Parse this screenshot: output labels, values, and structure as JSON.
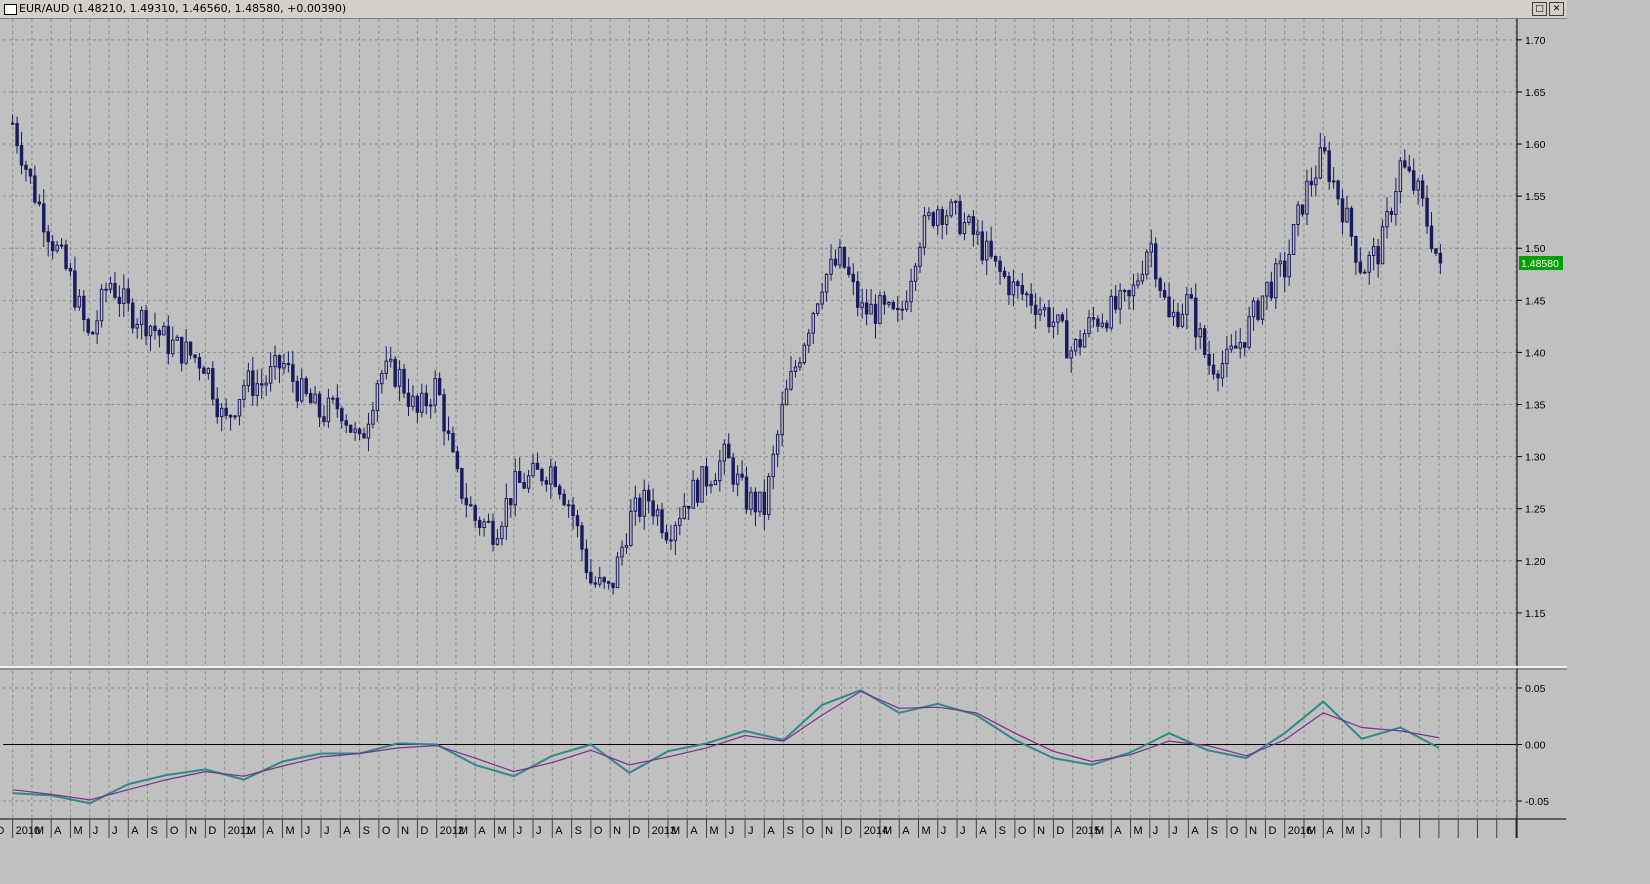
{
  "window": {
    "title": "EUR/AUD (1.48210, 1.49310, 1.46560, 1.48580, +0.00390)",
    "restore_glyph": "□",
    "close_glyph": "✕"
  },
  "colors": {
    "background": "#c0c0c0",
    "candle": "#1a1a5e",
    "grid": "#8c8c8c",
    "fast_line": "#2e8b83",
    "slow_line": "#7b2d8e",
    "price_tag_bg": "#00a000",
    "price_tag_text": "#ffffff"
  },
  "chart_data": [
    {
      "type": "candlestick",
      "title": "EUR/AUD",
      "last_price": "1.48580",
      "ylim": [
        1.1,
        1.72
      ],
      "y_ticks": [
        "1.70",
        "1.65",
        "1.60",
        "1.55",
        "1.50",
        "1.45",
        "1.40",
        "1.35",
        "1.30",
        "1.25",
        "1.20",
        "1.15"
      ],
      "grid": true,
      "x_labels": [
        "D",
        "2010",
        "M",
        "A",
        "M",
        "J",
        "J",
        "A",
        "S",
        "O",
        "N",
        "D",
        "2011",
        "M",
        "A",
        "M",
        "J",
        "J",
        "A",
        "S",
        "O",
        "N",
        "D",
        "2012",
        "M",
        "A",
        "M",
        "J",
        "J",
        "A",
        "S",
        "O",
        "N",
        "D",
        "2013",
        "M",
        "A",
        "M",
        "J",
        "J",
        "A",
        "S",
        "O",
        "N",
        "D",
        "2014",
        "M",
        "A",
        "M",
        "J",
        "J",
        "A",
        "S",
        "O",
        "N",
        "D",
        "2015",
        "M",
        "A",
        "M",
        "J",
        "J",
        "A",
        "S",
        "O",
        "N",
        "D",
        "2016",
        "M",
        "A",
        "M",
        "J"
      ],
      "close_path": [
        [
          "2010-01",
          1.62
        ],
        [
          "2010-02",
          1.56
        ],
        [
          "2010-03",
          1.51
        ],
        [
          "2010-04",
          1.47
        ],
        [
          "2010-05",
          1.41
        ],
        [
          "2010-06",
          1.47
        ],
        [
          "2010-07",
          1.44
        ],
        [
          "2010-08",
          1.43
        ],
        [
          "2010-09",
          1.41
        ],
        [
          "2010-10",
          1.4
        ],
        [
          "2010-11",
          1.39
        ],
        [
          "2010-12",
          1.33
        ],
        [
          "2011-01",
          1.37
        ],
        [
          "2011-02",
          1.37
        ],
        [
          "2011-03",
          1.39
        ],
        [
          "2011-04",
          1.36
        ],
        [
          "2011-05",
          1.34
        ],
        [
          "2011-06",
          1.35
        ],
        [
          "2011-07",
          1.31
        ],
        [
          "2011-08",
          1.38
        ],
        [
          "2011-09",
          1.38
        ],
        [
          "2011-10",
          1.34
        ],
        [
          "2011-11",
          1.37
        ],
        [
          "2011-12",
          1.28
        ],
        [
          "2012-01",
          1.24
        ],
        [
          "2012-02",
          1.23
        ],
        [
          "2012-03",
          1.27
        ],
        [
          "2012-04",
          1.28
        ],
        [
          "2012-05",
          1.29
        ],
        [
          "2012-06",
          1.25
        ],
        [
          "2012-07",
          1.18
        ],
        [
          "2012-08",
          1.17
        ],
        [
          "2012-09",
          1.24
        ],
        [
          "2012-10",
          1.26
        ],
        [
          "2012-11",
          1.23
        ],
        [
          "2012-12",
          1.26
        ],
        [
          "2013-01",
          1.28
        ],
        [
          "2013-02",
          1.3
        ],
        [
          "2013-03",
          1.26
        ],
        [
          "2013-04",
          1.25
        ],
        [
          "2013-05",
          1.35
        ],
        [
          "2013-06",
          1.41
        ],
        [
          "2013-07",
          1.47
        ],
        [
          "2013-08",
          1.49
        ],
        [
          "2013-09",
          1.44
        ],
        [
          "2013-10",
          1.44
        ],
        [
          "2013-11",
          1.43
        ],
        [
          "2013-12",
          1.51
        ],
        [
          "2014-01",
          1.54
        ],
        [
          "2014-02",
          1.53
        ],
        [
          "2014-03",
          1.51
        ],
        [
          "2014-04",
          1.48
        ],
        [
          "2014-05",
          1.46
        ],
        [
          "2014-06",
          1.45
        ],
        [
          "2014-07",
          1.43
        ],
        [
          "2014-08",
          1.4
        ],
        [
          "2014-09",
          1.43
        ],
        [
          "2014-10",
          1.44
        ],
        [
          "2014-11",
          1.45
        ],
        [
          "2014-12",
          1.51
        ],
        [
          "2015-01",
          1.43
        ],
        [
          "2015-02",
          1.45
        ],
        [
          "2015-03",
          1.39
        ],
        [
          "2015-04",
          1.39
        ],
        [
          "2015-05",
          1.42
        ],
        [
          "2015-06",
          1.46
        ],
        [
          "2015-07",
          1.48
        ],
        [
          "2015-08",
          1.55
        ],
        [
          "2015-09",
          1.59
        ],
        [
          "2015-10",
          1.54
        ],
        [
          "2015-11",
          1.48
        ],
        [
          "2015-12",
          1.5
        ],
        [
          "2016-01",
          1.58
        ],
        [
          "2016-02",
          1.55
        ],
        [
          "2016-03",
          1.4858
        ]
      ]
    },
    {
      "type": "line",
      "ylim": [
        -0.065,
        0.065
      ],
      "y_ticks": [
        "0.05",
        "0.00",
        "-0.05"
      ],
      "grid": true,
      "series": [
        {
          "color": "#2e8b83",
          "values": [
            [
              "2010-01",
              -0.043
            ],
            [
              "2010-03",
              -0.045
            ],
            [
              "2010-05",
              -0.052
            ],
            [
              "2010-07",
              -0.035
            ],
            [
              "2010-09",
              -0.027
            ],
            [
              "2010-11",
              -0.022
            ],
            [
              "2011-01",
              -0.031
            ],
            [
              "2011-03",
              -0.015
            ],
            [
              "2011-05",
              -0.008
            ],
            [
              "2011-07",
              -0.008
            ],
            [
              "2011-09",
              0.001
            ],
            [
              "2011-11",
              0.0
            ],
            [
              "2012-01",
              -0.018
            ],
            [
              "2012-03",
              -0.028
            ],
            [
              "2012-05",
              -0.01
            ],
            [
              "2012-07",
              0.0
            ],
            [
              "2012-09",
              -0.025
            ],
            [
              "2012-11",
              -0.006
            ],
            [
              "2013-01",
              0.001
            ],
            [
              "2013-03",
              0.012
            ],
            [
              "2013-05",
              0.004
            ],
            [
              "2013-07",
              0.035
            ],
            [
              "2013-09",
              0.048
            ],
            [
              "2013-11",
              0.028
            ],
            [
              "2014-01",
              0.036
            ],
            [
              "2014-03",
              0.026
            ],
            [
              "2014-05",
              0.004
            ],
            [
              "2014-07",
              -0.012
            ],
            [
              "2014-09",
              -0.018
            ],
            [
              "2014-11",
              -0.007
            ],
            [
              "2015-01",
              0.01
            ],
            [
              "2015-03",
              -0.005
            ],
            [
              "2015-05",
              -0.012
            ],
            [
              "2015-07",
              0.01
            ],
            [
              "2015-09",
              0.038
            ],
            [
              "2015-11",
              0.005
            ],
            [
              "2016-01",
              0.015
            ],
            [
              "2016-03",
              -0.003
            ]
          ]
        },
        {
          "color": "#7b2d8e",
          "values": [
            [
              "2010-01",
              -0.04
            ],
            [
              "2010-03",
              -0.044
            ],
            [
              "2010-05",
              -0.049
            ],
            [
              "2010-07",
              -0.04
            ],
            [
              "2010-09",
              -0.031
            ],
            [
              "2010-11",
              -0.024
            ],
            [
              "2011-01",
              -0.028
            ],
            [
              "2011-03",
              -0.019
            ],
            [
              "2011-05",
              -0.011
            ],
            [
              "2011-07",
              -0.008
            ],
            [
              "2011-09",
              -0.003
            ],
            [
              "2011-11",
              -0.001
            ],
            [
              "2012-01",
              -0.012
            ],
            [
              "2012-03",
              -0.024
            ],
            [
              "2012-05",
              -0.016
            ],
            [
              "2012-07",
              -0.005
            ],
            [
              "2012-09",
              -0.018
            ],
            [
              "2012-11",
              -0.011
            ],
            [
              "2013-01",
              -0.003
            ],
            [
              "2013-03",
              0.008
            ],
            [
              "2013-05",
              0.003
            ],
            [
              "2013-07",
              0.026
            ],
            [
              "2013-09",
              0.047
            ],
            [
              "2013-11",
              0.032
            ],
            [
              "2014-01",
              0.033
            ],
            [
              "2014-03",
              0.028
            ],
            [
              "2014-05",
              0.01
            ],
            [
              "2014-07",
              -0.006
            ],
            [
              "2014-09",
              -0.015
            ],
            [
              "2014-11",
              -0.009
            ],
            [
              "2015-01",
              0.003
            ],
            [
              "2015-03",
              -0.001
            ],
            [
              "2015-05",
              -0.01
            ],
            [
              "2015-07",
              0.004
            ],
            [
              "2015-09",
              0.028
            ],
            [
              "2015-11",
              0.015
            ],
            [
              "2016-01",
              0.012
            ],
            [
              "2016-03",
              0.006
            ]
          ]
        }
      ]
    }
  ]
}
